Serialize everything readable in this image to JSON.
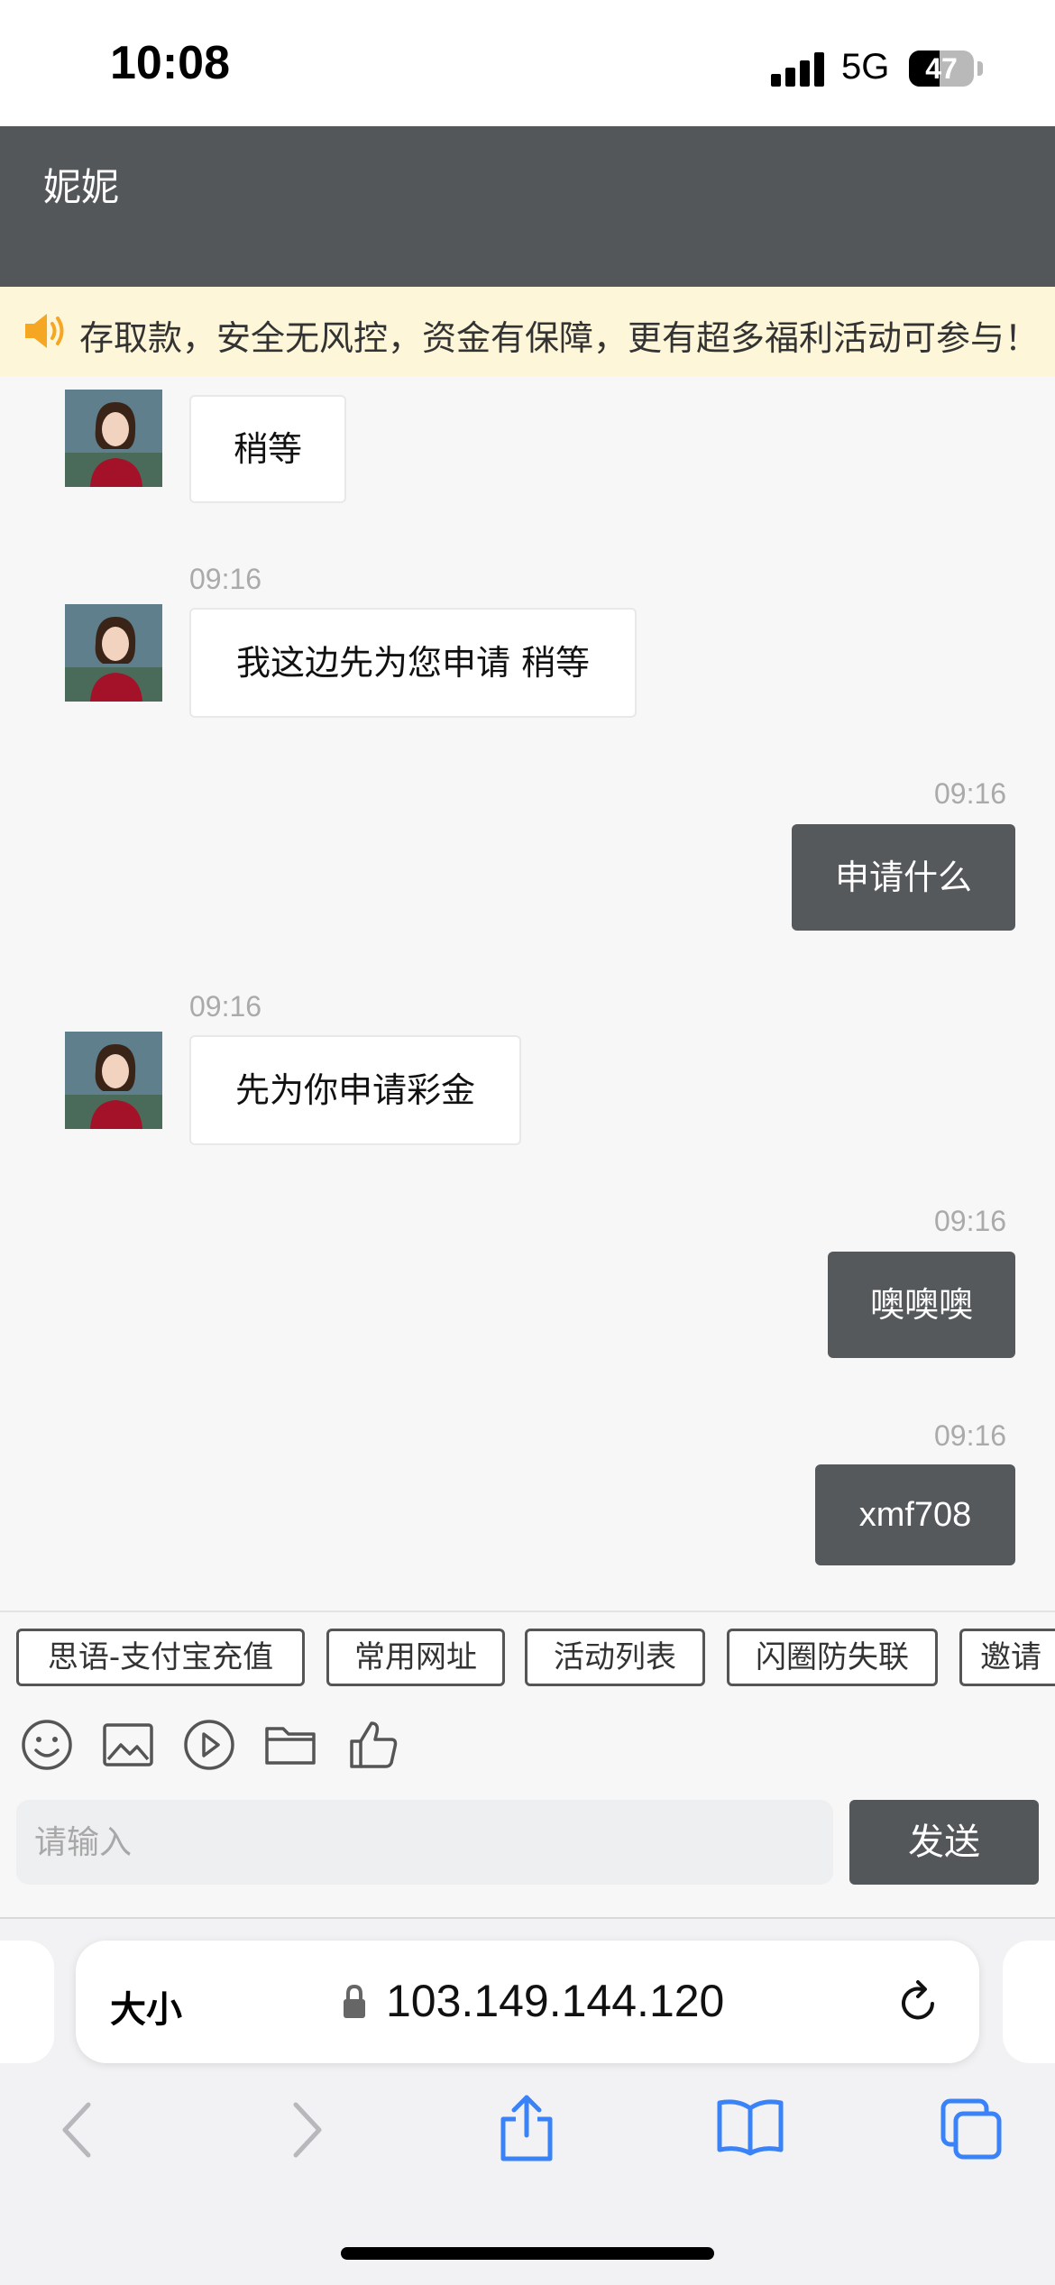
{
  "status_bar": {
    "time": "10:08",
    "network": "5G",
    "battery": "47",
    "battery_level": 0.47
  },
  "header": {
    "title": "妮妮"
  },
  "notice": {
    "text": "存取款，安全无风控，资金有保障，更有超多福利活动可参与！"
  },
  "messages": [
    {
      "side": "in",
      "time": "09:16",
      "text": "稍等"
    },
    {
      "side": "in",
      "time": "09:16",
      "text": "我这边先为您申请 稍等"
    },
    {
      "side": "out",
      "time": "09:16",
      "text": "申请什么"
    },
    {
      "side": "in",
      "time": "09:16",
      "text": "先为你申请彩金"
    },
    {
      "side": "out",
      "time": "09:16",
      "text": "噢噢噢"
    },
    {
      "side": "out",
      "time": "09:16",
      "text": "xmf708"
    }
  ],
  "quick_replies": [
    "思语-支付宝充值",
    "常用网址",
    "活动列表",
    "闪圈防失联",
    "邀请"
  ],
  "toolbar_icons": [
    "emoji-icon",
    "image-icon",
    "video-icon",
    "folder-icon",
    "thumbs-up-icon"
  ],
  "input": {
    "placeholder": "请输入",
    "value": ""
  },
  "send_label": "发送",
  "browser": {
    "text_size_label": "大小",
    "url": "103.149.144.120"
  },
  "colors": {
    "header": "#54575a",
    "outgoing_bubble": "#56595c",
    "notice_bg": "#fdf6d8",
    "notice_icon": "#f5a623",
    "browser_accent": "#3a82f7"
  }
}
